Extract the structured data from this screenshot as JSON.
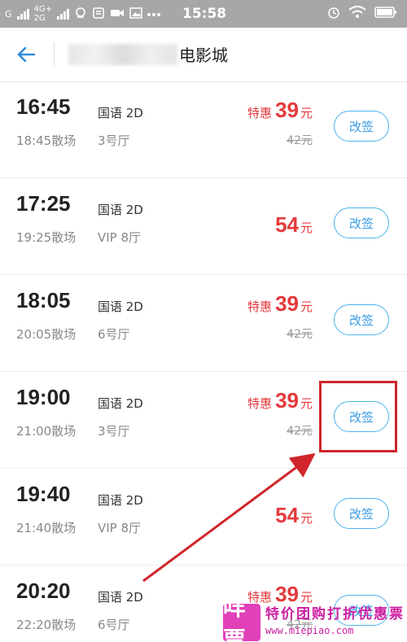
{
  "status_bar": {
    "carrier_g": "G",
    "net_top": "4G+",
    "net_bottom": "2G",
    "time": "15:58"
  },
  "header": {
    "title": "电影城"
  },
  "sessions": [
    {
      "start": "16:45",
      "end": "18:45散场",
      "lang": "国语 2D",
      "hall": "3号厅",
      "promo": "特惠",
      "price": "39",
      "unit": "元",
      "orig": "42元",
      "action": "改签"
    },
    {
      "start": "17:25",
      "end": "19:25散场",
      "lang": "国语 2D",
      "hall": "VIP 8厅",
      "promo": "",
      "price": "54",
      "unit": "元",
      "orig": "",
      "action": "改签"
    },
    {
      "start": "18:05",
      "end": "20:05散场",
      "lang": "国语 2D",
      "hall": "6号厅",
      "promo": "特惠",
      "price": "39",
      "unit": "元",
      "orig": "42元",
      "action": "改签"
    },
    {
      "start": "19:00",
      "end": "21:00散场",
      "lang": "国语 2D",
      "hall": "3号厅",
      "promo": "特惠",
      "price": "39",
      "unit": "元",
      "orig": "42元",
      "action": "改签"
    },
    {
      "start": "19:40",
      "end": "21:40散场",
      "lang": "国语 2D",
      "hall": "VIP 8厅",
      "promo": "",
      "price": "54",
      "unit": "元",
      "orig": "",
      "action": "改签"
    },
    {
      "start": "20:20",
      "end": "22:20散场",
      "lang": "国语 2D",
      "hall": "6号厅",
      "promo": "特惠",
      "price": "39",
      "unit": "元",
      "orig": "42元",
      "action": "改签"
    }
  ],
  "watermark": {
    "logo": "咩票",
    "slogan": "特价团购打折优惠票",
    "url": "www.miepiao.com"
  },
  "colors": {
    "accent_blue": "#3a9be3",
    "price_red": "#e4393c",
    "annotation_red": "#d0262c"
  },
  "icons": [
    "signal-icon",
    "wifi-icon",
    "alarm-icon",
    "battery-icon",
    "back-arrow-icon"
  ]
}
